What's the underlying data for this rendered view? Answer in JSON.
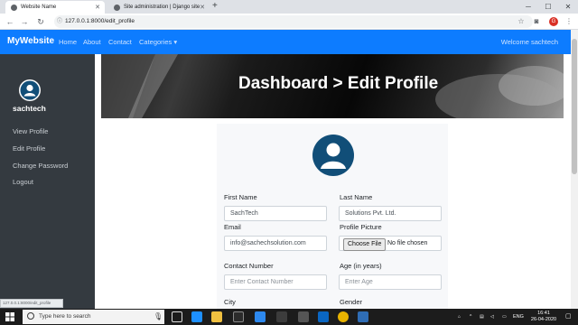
{
  "browser": {
    "tabs": [
      {
        "title": "Website Name"
      },
      {
        "title": "Site administration | Django site"
      }
    ],
    "new_tab": "+",
    "url": "127.0.0.1:8000/edit_profile",
    "status_url": "127.0.0.1:8000/edit_profile"
  },
  "site": {
    "brand": "MyWebsite",
    "nav": [
      "Home",
      "About",
      "Contact",
      "Categories ▾"
    ],
    "welcome": "Welcome sachtech"
  },
  "sidebar": {
    "username": "sachtech",
    "items": [
      "View Profile",
      "Edit Profile",
      "Change Password",
      "Logout"
    ]
  },
  "banner": {
    "title": "Dashboard > Edit Profile"
  },
  "form": {
    "first_name": {
      "label": "First Name",
      "value": "SachTech"
    },
    "last_name": {
      "label": "Last Name",
      "value": "Solutions Pvt. Ltd."
    },
    "email": {
      "label": "Email",
      "value": "info@sachechsolution.com"
    },
    "profile_picture": {
      "label": "Profile Picture",
      "button": "Choose File",
      "status": "No file chosen"
    },
    "contact": {
      "label": "Contact Number",
      "placeholder": "Enter Contact Number"
    },
    "age": {
      "label": "Age (in years)",
      "placeholder": "Enter Age"
    },
    "city": {
      "label": "City"
    },
    "gender": {
      "label": "Gender"
    }
  },
  "taskbar": {
    "search_placeholder": "Type here to search",
    "lang": "ENG",
    "time": "16:41",
    "date": "26-04-2020"
  },
  "colors": {
    "navbar": "#0d7cff",
    "sidebar": "#343a40",
    "avatar": "#114e78"
  }
}
